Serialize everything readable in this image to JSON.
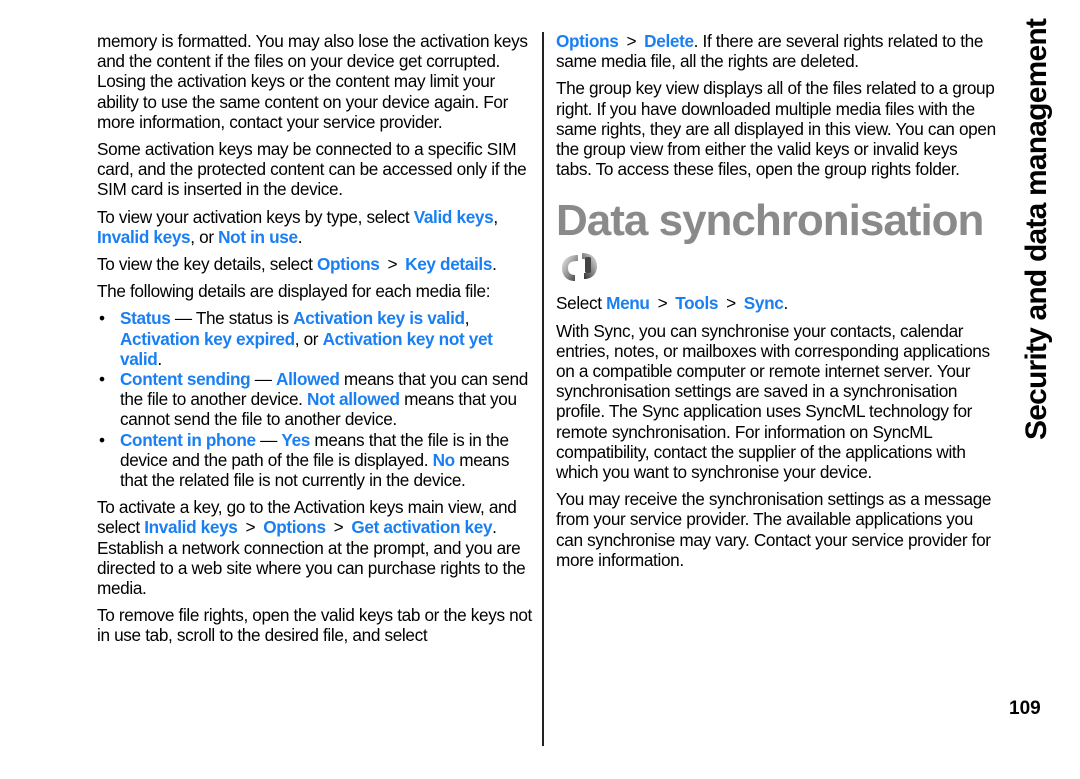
{
  "section_title": "Security and data management",
  "page_number": "109",
  "colors": {
    "link_blue": "#1a7ff2",
    "heading_gray": "#8a8a8a",
    "text": "#000000"
  },
  "separator": ">",
  "left_column": {
    "p1": "memory is formatted. You may also lose the activation keys and the content if the files on your device get corrupted. Losing the activation keys or the content may limit your ability to use the same content on your device again. For more information, contact your service provider.",
    "p2": "Some activation keys may be connected to a specific SIM card, and the protected content can be accessed only if the SIM card is inserted in the device.",
    "p3": {
      "t1": "To view your activation keys by type, select ",
      "l1": "Valid keys",
      "t2": ", ",
      "l2": "Invalid keys",
      "t3": ", or ",
      "l3": "Not in use",
      "t4": "."
    },
    "p4": {
      "t1": "To view the key details, select ",
      "l1": "Options",
      "l2": "Key details",
      "t2": "."
    },
    "p5": "The following details are displayed for each media file:",
    "bullets": [
      {
        "term": "Status",
        "t1": " — The status is ",
        "l1": "Activation key is valid",
        "t2": ", ",
        "l2": "Activation key expired",
        "t3": ", or ",
        "l3": "Activation key not yet valid",
        "t4": "."
      },
      {
        "term": "Content sending",
        "t1": " — ",
        "l1": "Allowed",
        "t2": " means that you can send the file to another device. ",
        "l2": "Not allowed",
        "t3": " means that you cannot send the file to another device."
      },
      {
        "term": "Content in phone",
        "t1": " — ",
        "l1": "Yes",
        "t2": " means that the file is in the device and the path of the file is displayed. ",
        "l2": "No",
        "t3": " means that the related file is not currently in the device."
      }
    ],
    "p6": {
      "t1": "To activate a key, go to the Activation keys main view, and select ",
      "l1": "Invalid keys",
      "l2": "Options",
      "l3": "Get activation key",
      "t2": ". Establish a network connection at the prompt, and you are directed to a web site where you can purchase rights to the media."
    },
    "p7": "To remove file rights, open the valid keys tab or the keys not in use tab, scroll to the desired file, and select"
  },
  "right_column": {
    "p1": {
      "l1": "Options",
      "l2": "Delete",
      "t1": ". If there are several rights related to the same media file, all the rights are deleted."
    },
    "p2": "The group key view displays all of the files related to a group right. If you have downloaded multiple media files with the same rights, they are all displayed in this view. You can open the group view from either the valid keys or invalid keys tabs. To access these files, open the group rights folder.",
    "heading": "Data synchronisation",
    "icon": "sync-icon",
    "p3": {
      "t1": "Select ",
      "l1": "Menu",
      "l2": "Tools",
      "l3": "Sync",
      "t2": "."
    },
    "p4": "With Sync, you can synchronise your contacts, calendar entries, notes, or mailboxes with corresponding applications on a compatible computer or remote internet server. Your synchronisation settings are saved in a synchronisation profile. The Sync application uses SyncML technology for remote synchronisation. For information on SyncML compatibility, contact the supplier of the applications with which you want to synchronise your device.",
    "p5": "You may receive the synchronisation settings as a message from your service provider. The available applications you can synchronise may vary. Contact your service provider for more information."
  }
}
